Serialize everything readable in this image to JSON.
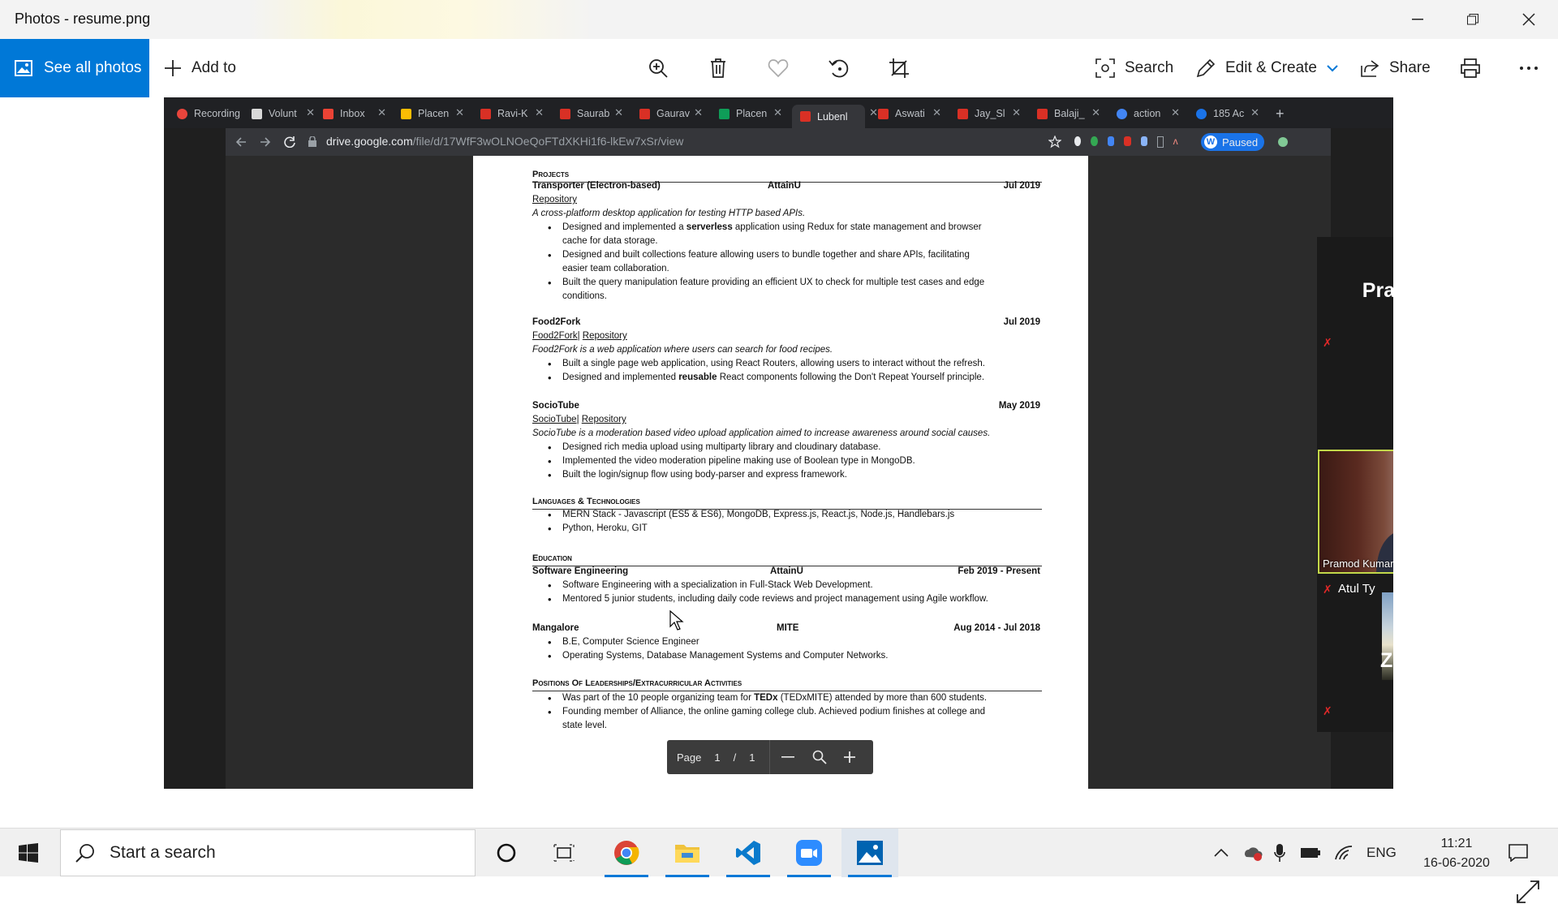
{
  "window": {
    "title": "Photos - resume.png"
  },
  "toolbar": {
    "see_all_photos": "See all photos",
    "add_to": "Add to",
    "search": "Search",
    "edit_create": "Edit & Create",
    "share": "Share",
    "icons": [
      "zoom-in-icon",
      "delete-icon",
      "favorite-icon",
      "rotate-icon",
      "crop-icon",
      "print-icon",
      "more-icon"
    ]
  },
  "browser": {
    "tabs": [
      {
        "label": "Recording",
        "color": "#e8453c"
      },
      {
        "label": "Volunt",
        "color": "#d9d9d9"
      },
      {
        "label": "Inbox",
        "color": "#ea4335"
      },
      {
        "label": "Placen",
        "color": "#fbbc04"
      },
      {
        "label": "Ravi-K",
        "color": "#d93025"
      },
      {
        "label": "Saurab",
        "color": "#d93025"
      },
      {
        "label": "Gaurav",
        "color": "#d93025"
      },
      {
        "label": "Placen",
        "color": "#0f9d58"
      },
      {
        "label": "Lubenl",
        "color": "#d93025"
      },
      {
        "label": "Aswati",
        "color": "#d93025"
      },
      {
        "label": "Jay_Sl",
        "color": "#d93025"
      },
      {
        "label": "Balaji_",
        "color": "#d93025"
      },
      {
        "label": "action",
        "color": "#4285f4"
      },
      {
        "label": "185 Ac",
        "color": "#1a73e8"
      }
    ],
    "url_host": "drive.google.com",
    "url_path": "/file/d/17WfF3wOLNOeQoFTdXKHi1f6-lkEw7xSr/view",
    "paused_label": "Paused"
  },
  "resume": {
    "projects_heading": "Projects",
    "p1_title": "Transporter (Electron-based)",
    "p1_org": "AttainU",
    "p1_date": "Jul 2019",
    "p1_link": "Repository",
    "p1_desc": "A cross-platform desktop application for testing HTTP based APIs.",
    "p1_b1a": "Designed and implemented a ",
    "p1_b1b": "serverless",
    "p1_b1c": " application using Redux for state management and browser",
    "p1_b1d": "cache for data storage.",
    "p1_b2a": "Designed and built collections feature allowing users to bundle together and share APIs, facilitating",
    "p1_b2b": "easier team collaboration.",
    "p1_b3a": "Built the query manipulation feature providing an efficient UX to check for multiple test cases and edge",
    "p1_b3b": "conditions.",
    "p2_title": "Food2Fork",
    "p2_date": "Jul 2019",
    "p2_link1": "Food2Fork",
    "p2_link2": "Repository",
    "p2_desc": "Food2Fork is a web application where users can search for food recipes.",
    "p2_b1": "Built a single page web application, using React Routers, allowing users to interact without the refresh.",
    "p2_b2a": "Designed and implemented ",
    "p2_b2b": "reusable",
    "p2_b2c": " React components following the Don't Repeat Yourself principle.",
    "p3_title": "SocioTube",
    "p3_date": "May 2019",
    "p3_link1": "SocioTube",
    "p3_link2": "Repository",
    "p3_desc": "SocioTube is a moderation based video upload application aimed to increase awareness around social causes.",
    "p3_b1": "Designed rich media upload using multiparty library and cloudinary database.",
    "p3_b2": "Implemented the video moderation pipeline making use of Boolean type in MongoDB.",
    "p3_b3": "Built the login/signup flow using body-parser and express framework.",
    "lang_heading": "Languages & Technologies",
    "lang_b1": "MERN Stack - Javascript (ES5 & ES6), MongoDB, Express.js, React.js, Node.js, Handlebars.js",
    "lang_b2": "Python, Heroku, GIT",
    "edu_heading": "Education",
    "e1_title": "Software Engineering",
    "e1_org": "AttainU",
    "e1_date": "Feb 2019 - Present",
    "e1_b1": "Software Engineering with a specialization in Full-Stack Web Development.",
    "e1_b2": "Mentored 5 junior students, including daily code reviews and project management using Agile workflow.",
    "e2_title": "Mangalore",
    "e2_org": "MITE",
    "e2_date": "Aug 2014 - Jul 2018",
    "e2_b1": "B.E, Computer Science Engineer",
    "e2_b2": "Operating Systems, Database Management Systems and Computer Networks.",
    "pos_heading": "Positions Of Leaderships/Extracurricular Activities",
    "pos_b1a": "Was part of the 10 people organizing team for ",
    "pos_b1b": "TEDx",
    "pos_b1c": " (TEDxMITE) attended by more than 600 students.",
    "pos_b2a": "Founding member of Alliance, the online gaming college club. Achieved podium finishes at college and",
    "pos_b2b": "state level."
  },
  "pager": {
    "label": "Page",
    "current": "1",
    "slash": "/",
    "total": "1"
  },
  "zoom": {
    "p1_name": "Pragya Sinha",
    "p2_name": "Pramod Kumar",
    "p3_name": "Atul Ty",
    "p4_name": "ZSheldon"
  },
  "taskbar": {
    "search_placeholder": "Start a search",
    "lang": "ENG",
    "time": "11:21",
    "date": "16-06-2020"
  }
}
